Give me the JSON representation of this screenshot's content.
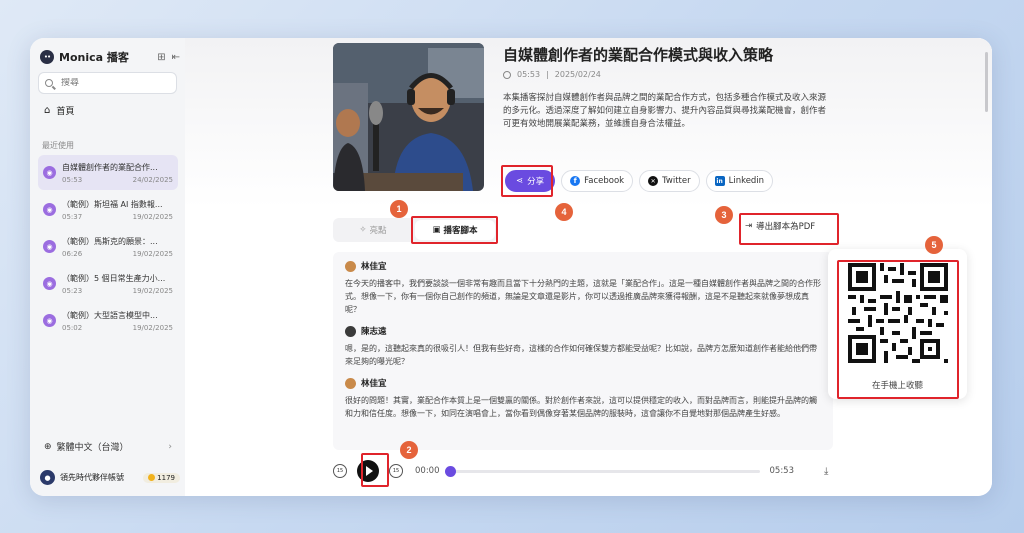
{
  "app": {
    "name": "Monica 播客"
  },
  "sidebar": {
    "search_placeholder": "搜尋",
    "home_label": "首頁",
    "recent_label": "最近使用",
    "items": [
      {
        "title": "自媒體創作者的業配合作...",
        "duration": "05:53",
        "date": "24/02/2025",
        "active": true
      },
      {
        "title": "（範例）斯坦福 AI 指數報...",
        "duration": "05:37",
        "date": "19/02/2025",
        "active": false
      },
      {
        "title": "（範例）馬斯克的願景：...",
        "duration": "06:26",
        "date": "19/02/2025",
        "active": false
      },
      {
        "title": "（範例）5 個日常生產力小...",
        "duration": "05:23",
        "date": "19/02/2025",
        "active": false
      },
      {
        "title": "（範例）大型語言模型中...",
        "duration": "05:02",
        "date": "19/02/2025",
        "active": false
      }
    ],
    "language": "繁體中文（台灣）",
    "user_name": "領先時代夥伴帳號",
    "credits": "1179"
  },
  "episode": {
    "title": "自媒體創作者的業配合作模式與收入策略",
    "duration": "05:53",
    "date": "2025/02/24",
    "description": "本集播客探討自媒體創作者與品牌之間的業配合作方式，包括多種合作模式及收入來源的多元化。透過深度了解如何建立自身影響力、提升內容品質與尋找業配機會，創作者可更有效地開展業配業務，並維護自身合法權益。"
  },
  "share": {
    "share_label": "分享",
    "facebook_label": "Facebook",
    "twitter_label": "Twitter",
    "linkedin_label": "Linkedin"
  },
  "tabs": {
    "highlights_label": "亮點",
    "script_label": "播客腳本"
  },
  "export_label": "導出腳本為PDF",
  "transcript": [
    {
      "speaker": "林佳宜",
      "text": "在今天的播客中，我們要談談一個非常有趣而且當下十分熱門的主題，這就是「業配合作」。這是一種自媒體創作者與品牌之間的合作形式。想像一下，你有一個你自己創作的頻道，無論是文章還是影片，你可以透過推廣品牌來獲得報酬，這是不是聽起來就像夢想成真呢？"
    },
    {
      "speaker": "陳志遠",
      "text": "嗯，是的，這聽起來真的很吸引人！但我有些好奇，這樣的合作如何確保雙方都能受益呢？比如說，品牌方怎麼知道創作者能給他們帶來足夠的曝光呢？"
    },
    {
      "speaker": "林佳宜",
      "text": "很好的問題！其實，業配合作本質上是一個雙贏的關係。對於創作者來說，這可以提供穩定的收入，而對品牌而言，則能提升品牌的觸和力和信任度。想像一下，如同在演唱會上，當你看到偶像穿著某個品牌的服裝時，這會讓你不自覺地對那個品牌產生好感。"
    }
  ],
  "player": {
    "current_time": "00:00",
    "total_time": "05:53",
    "progress": 0,
    "skip_back": "15",
    "skip_forward": "15"
  },
  "qr": {
    "label": "在手機上收聽"
  },
  "annotations": [
    "1",
    "2",
    "3",
    "4",
    "5"
  ],
  "colors": {
    "accent": "#6a4be0",
    "annotation": "#e0242b",
    "badge": "#e5633b"
  }
}
